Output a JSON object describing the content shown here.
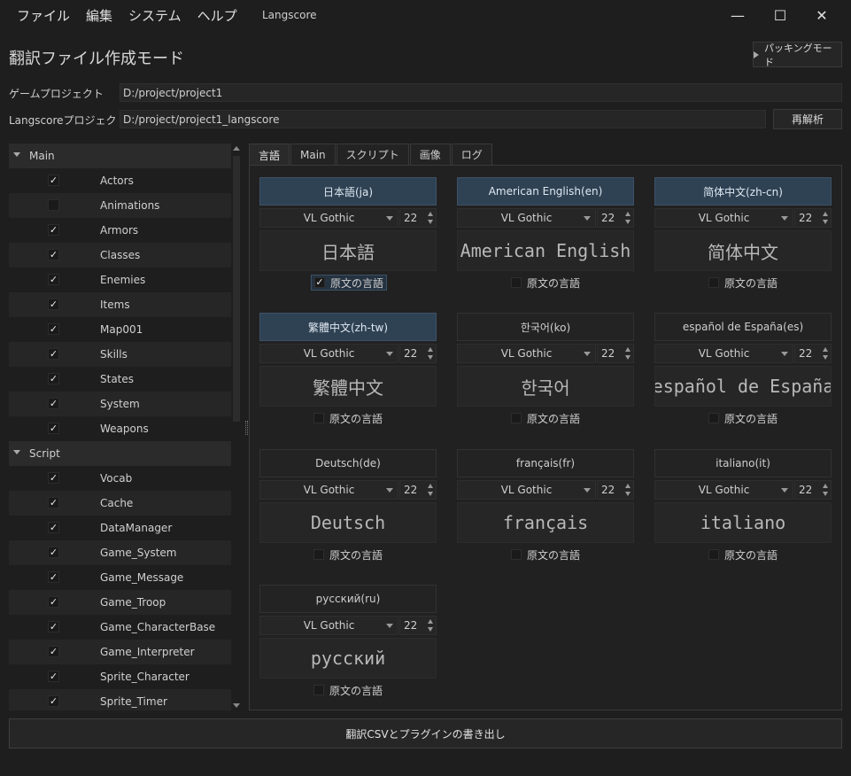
{
  "menu": [
    "ファイル",
    "編集",
    "システム",
    "ヘルプ"
  ],
  "app_title": "Langscore",
  "window_controls": {
    "minimize": "—",
    "maximize": "☐",
    "close": "✕"
  },
  "mode_title": "翻訳ファイル作成モード",
  "packing_button": "パッキングモード",
  "game_project": {
    "label": "ゲームプロジェクト",
    "value": "D:/project/project1"
  },
  "langscore_project": {
    "label": "Langscoreプロジェクト",
    "value": "D:/project/project1_langscore"
  },
  "reanalyze_button": "再解析",
  "tree": [
    {
      "type": "category",
      "label": "Main"
    },
    {
      "type": "item",
      "label": "Actors",
      "checked": true
    },
    {
      "type": "item",
      "label": "Animations",
      "checked": false
    },
    {
      "type": "item",
      "label": "Armors",
      "checked": true
    },
    {
      "type": "item",
      "label": "Classes",
      "checked": true
    },
    {
      "type": "item",
      "label": "Enemies",
      "checked": true
    },
    {
      "type": "item",
      "label": "Items",
      "checked": true
    },
    {
      "type": "item",
      "label": "Map001",
      "checked": true
    },
    {
      "type": "item",
      "label": "Skills",
      "checked": true
    },
    {
      "type": "item",
      "label": "States",
      "checked": true
    },
    {
      "type": "item",
      "label": "System",
      "checked": true
    },
    {
      "type": "item",
      "label": "Weapons",
      "checked": true
    },
    {
      "type": "category",
      "label": "Script"
    },
    {
      "type": "item",
      "label": "Vocab",
      "checked": true
    },
    {
      "type": "item",
      "label": "Cache",
      "checked": true
    },
    {
      "type": "item",
      "label": "DataManager",
      "checked": true
    },
    {
      "type": "item",
      "label": "Game_System",
      "checked": true
    },
    {
      "type": "item",
      "label": "Game_Message",
      "checked": true
    },
    {
      "type": "item",
      "label": "Game_Troop",
      "checked": true
    },
    {
      "type": "item",
      "label": "Game_CharacterBase",
      "checked": true
    },
    {
      "type": "item",
      "label": "Game_Interpreter",
      "checked": true
    },
    {
      "type": "item",
      "label": "Sprite_Character",
      "checked": true
    },
    {
      "type": "item",
      "label": "Sprite_Timer",
      "checked": true
    }
  ],
  "tabs": [
    {
      "label": "言語",
      "active": true
    },
    {
      "label": "Main",
      "active": false
    },
    {
      "label": "スクリプト",
      "active": false
    },
    {
      "label": "画像",
      "active": false
    },
    {
      "label": "ログ",
      "active": false
    }
  ],
  "original_language_label": "原文の言語",
  "languages": [
    {
      "header": "日本語(ja)",
      "selected": true,
      "font": "VL Gothic",
      "size": "22",
      "preview": "日本語",
      "original": true
    },
    {
      "header": "American English(en)",
      "selected": true,
      "font": "VL Gothic",
      "size": "22",
      "preview": "American English",
      "original": false
    },
    {
      "header": "简体中文(zh-cn)",
      "selected": true,
      "font": "VL Gothic",
      "size": "22",
      "preview": "简体中文",
      "original": false
    },
    {
      "header": "繁體中文(zh-tw)",
      "selected": true,
      "font": "VL Gothic",
      "size": "22",
      "preview": "繁體中文",
      "original": false
    },
    {
      "header": "한국어(ko)",
      "selected": false,
      "font": "VL Gothic",
      "size": "22",
      "preview": "한국어",
      "original": false
    },
    {
      "header": "español de España(es)",
      "selected": false,
      "font": "VL Gothic",
      "size": "22",
      "preview": "español de España",
      "original": false
    },
    {
      "header": "Deutsch(de)",
      "selected": false,
      "font": "VL Gothic",
      "size": "22",
      "preview": "Deutsch",
      "original": false
    },
    {
      "header": "français(fr)",
      "selected": false,
      "font": "VL Gothic",
      "size": "22",
      "preview": "français",
      "original": false
    },
    {
      "header": "italiano(it)",
      "selected": false,
      "font": "VL Gothic",
      "size": "22",
      "preview": "italiano",
      "original": false
    },
    {
      "header": "русский(ru)",
      "selected": false,
      "font": "VL Gothic",
      "size": "22",
      "preview": "русский",
      "original": false
    }
  ],
  "export_button": "翻訳CSVとプラグインの書き出し"
}
